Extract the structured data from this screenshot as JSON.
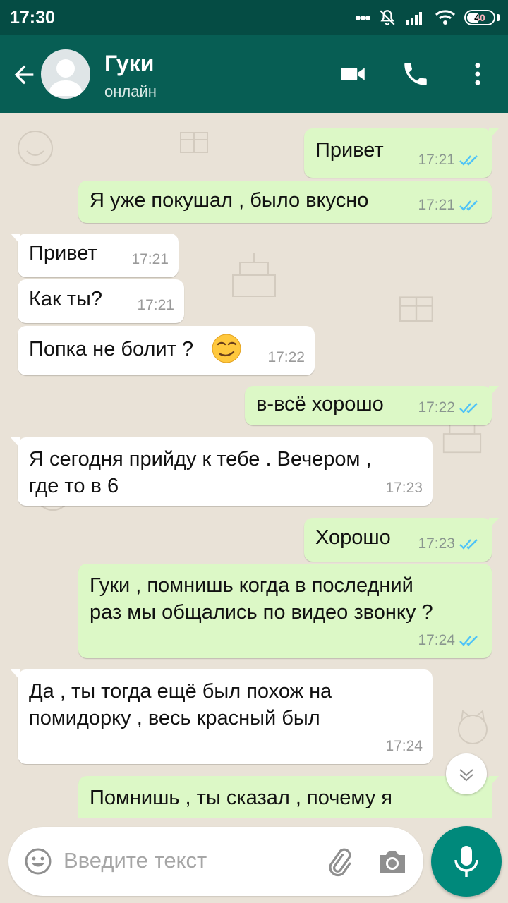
{
  "status_bar": {
    "time": "17:30",
    "battery": "40"
  },
  "header": {
    "name": "Гуки",
    "status": "онлайн"
  },
  "messages": [
    {
      "direction": "out",
      "text": "Привет",
      "time": "17:21",
      "read": true
    },
    {
      "direction": "out",
      "text": "Я уже покушал , было вкусно",
      "time": "17:21",
      "read": true
    },
    {
      "direction": "in",
      "text": "Привет",
      "time": "17:21"
    },
    {
      "direction": "in",
      "text": "Как ты?",
      "time": "17:21"
    },
    {
      "direction": "in",
      "text": "Попка не болит ?",
      "emoji": "smirk",
      "time": "17:22"
    },
    {
      "direction": "out",
      "text": "в-всё хорошо",
      "time": "17:22",
      "read": true
    },
    {
      "direction": "in",
      "text": "Я сегодня прийду к тебе . Вечером ,\nгде то в 6",
      "time": "17:23"
    },
    {
      "direction": "out",
      "text": "Хорошо",
      "time": "17:23",
      "read": true
    },
    {
      "direction": "out",
      "text": "Гуки , помнишь когда в последний\nраз мы общались по видео звонку ?",
      "time": "17:24",
      "read": true
    },
    {
      "direction": "in",
      "text": "Да , ты тогда ещё был похож на\nпомидорку , весь красный был",
      "time": "17:24"
    },
    {
      "direction": "out",
      "text": "Помнишь , ты сказал , почему я",
      "time": "",
      "read": false
    }
  ],
  "composer": {
    "placeholder": "Введите текст"
  },
  "colors": {
    "header": "#075e54",
    "status_bar": "#054c44",
    "outgoing": "#dcf8c6",
    "incoming": "#ffffff",
    "read_ticks": "#4fc3f7",
    "mic_button": "#00897b"
  },
  "icons": [
    "back-arrow-icon",
    "video-call-icon",
    "phone-icon",
    "more-vert-icon",
    "emoji-icon",
    "attach-icon",
    "camera-icon",
    "mic-icon",
    "chevron-down-icon"
  ]
}
